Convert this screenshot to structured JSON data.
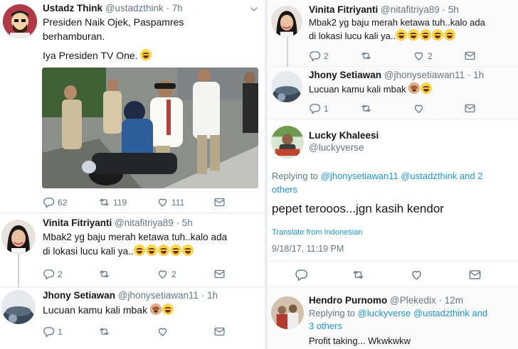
{
  "left": {
    "tweet_main": {
      "name": "Ustadz Think",
      "handle": "@ustadzthink · 7h",
      "line1": "Presiden Naik Ojek, Paspamres",
      "line2": "berhamburan.",
      "line3": "Iya Presiden TV One.",
      "replies": "62",
      "retweets": "119",
      "likes": "111"
    },
    "tweet_vinita": {
      "name": "Vinita Fitriyanti",
      "handle": "@nitafitriya89 · 5h",
      "line1": "Mbak2 yg baju merah ketawa tuh..kalo ada",
      "line2": "di lokasi lucu kali ya..",
      "replies": "2",
      "likes": "2"
    },
    "tweet_jhony": {
      "name": "Jhony Setiawan",
      "handle": "@jhonysetiawan11 · 1h",
      "text": "Lucuan kamu kali mbak",
      "replies": "1"
    }
  },
  "right": {
    "tweet_vinita": {
      "name": "Vinita Fitriyanti",
      "handle": "@nitafitriya89 · 5h",
      "line1": "Mbak2 yg baju merah ketawa tuh..kalo ada",
      "line2": "di lokasi lucu kali ya..",
      "replies": "2",
      "likes": "2"
    },
    "tweet_jhony": {
      "name": "Jhony Setiawan",
      "handle": "@jhonysetiawan11 · 1h",
      "text": "Lucuan kamu kali mbak",
      "replies": "1"
    },
    "tweet_lucky": {
      "name": "Lucky Khaleesi",
      "handle": "@luckyverse",
      "replying_prefix": "Replying to",
      "replying_users_line1": "@jhonysetiawan11 @ustadzthink and 2",
      "replying_users_line2": "others",
      "text": "pepet terooos...jgn kasih kendor",
      "translate": "Translate from Indonesian",
      "timestamp": "9/18/17, 11:19 PM"
    },
    "tweet_hendro": {
      "name": "Hendro Purnomo",
      "handle": "@Plekedix · 12m",
      "replying_prefix": "Replying to",
      "replying_users_line1": "@luckyverse @ustadzthink and",
      "replying_users_line2": "3 others",
      "text": "Profit taking... Wkwkwkw"
    }
  },
  "colors": {
    "link": "#1b95e0",
    "muted": "#657786",
    "text": "#14171a",
    "border": "#e6ecf0"
  },
  "icons": [
    "reply-icon",
    "retweet-icon",
    "like-icon",
    "message-icon",
    "chevron-down-icon"
  ]
}
